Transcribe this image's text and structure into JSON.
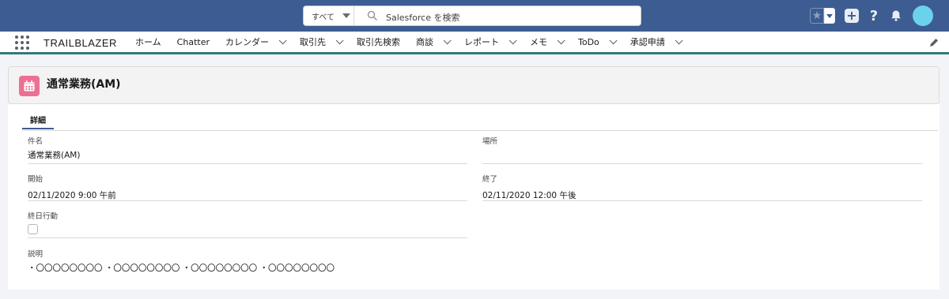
{
  "header": {
    "search_scope": "すべて",
    "search_placeholder": "Salesforce を検索",
    "help_icon_text": "?"
  },
  "nav": {
    "app_name": "TRAILBLAZER",
    "items": [
      {
        "label": "ホーム",
        "dropdown": false
      },
      {
        "label": "Chatter",
        "dropdown": false
      },
      {
        "label": "カレンダー",
        "dropdown": true
      },
      {
        "label": "取引先",
        "dropdown": true
      },
      {
        "label": "取引先検索",
        "dropdown": false
      },
      {
        "label": "商談",
        "dropdown": true
      },
      {
        "label": "レポート",
        "dropdown": true
      },
      {
        "label": "メモ",
        "dropdown": true
      },
      {
        "label": "ToDo",
        "dropdown": true
      },
      {
        "label": "承認申請",
        "dropdown": true
      }
    ]
  },
  "record": {
    "title": "通常業務(AM)"
  },
  "tabs": {
    "details": "詳細"
  },
  "fields": {
    "subject_label": "件名",
    "subject_value": "通常業務(AM)",
    "location_label": "場所",
    "location_value": "",
    "start_label": "開始",
    "start_value": "02/11/2020 9:00 午前",
    "end_label": "終了",
    "end_value": "02/11/2020 12:00 午後",
    "allday_label": "終日行動",
    "description_label": "説明",
    "description_value": "・〇〇〇〇〇〇〇〇 ・〇〇〇〇〇〇〇〇 ・〇〇〇〇〇〇〇〇 ・〇〇〇〇〇〇〇〇"
  },
  "colors": {
    "header_bg": "#3d5c91",
    "nav_underline": "#2f7b78",
    "event_icon": "#eb7092",
    "avatar": "#6ad2ea"
  }
}
